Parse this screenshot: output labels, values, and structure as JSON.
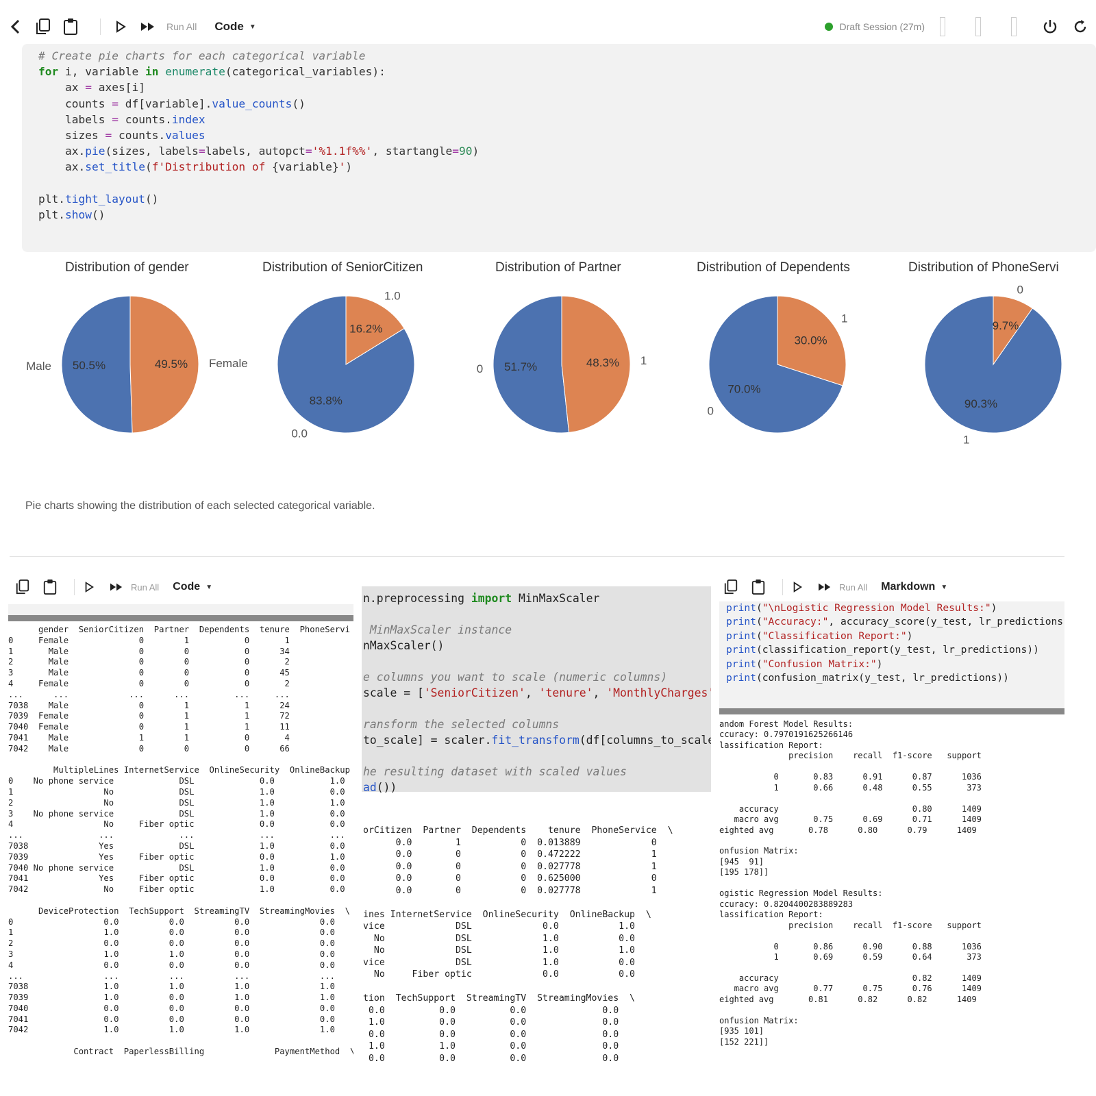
{
  "top_toolbar": {
    "run_all": "Run All",
    "cell_type": "Code",
    "session": "Draft Session (27m)",
    "session_status_color": "#2ca02c",
    "icons": [
      "back-icon",
      "copy-icon",
      "clipboard-icon",
      "run-icon",
      "run-all-icon",
      "power-icon",
      "refresh-icon"
    ]
  },
  "top_code": {
    "comment": "# Create pie charts for each categorical variable"
  },
  "charts_caption": "Pie charts showing the distribution of each selected categorical variable.",
  "chart_data": [
    {
      "type": "pie",
      "title": "Distribution of gender",
      "labels": [
        "Male",
        "Female"
      ],
      "values": [
        50.5,
        49.5
      ],
      "value_labels": [
        "50.5%",
        "49.5%"
      ],
      "colors": [
        "#4c72b0",
        "#dd8452"
      ],
      "startangle": 90
    },
    {
      "type": "pie",
      "title": "Distribution of SeniorCitizen",
      "labels": [
        "0.0",
        "1.0"
      ],
      "values": [
        83.8,
        16.2
      ],
      "value_labels": [
        "83.8%",
        "16.2%"
      ],
      "colors": [
        "#4c72b0",
        "#dd8452"
      ],
      "startangle": 90
    },
    {
      "type": "pie",
      "title": "Distribution of Partner",
      "labels": [
        "0",
        "1"
      ],
      "values": [
        51.7,
        48.3
      ],
      "value_labels": [
        "51.7%",
        "48.3%"
      ],
      "colors": [
        "#4c72b0",
        "#dd8452"
      ],
      "startangle": 90
    },
    {
      "type": "pie",
      "title": "Distribution of Dependents",
      "labels": [
        "0",
        "1"
      ],
      "values": [
        70.0,
        30.0
      ],
      "value_labels": [
        "70.0%",
        "30.0%"
      ],
      "colors": [
        "#4c72b0",
        "#dd8452"
      ],
      "startangle": 90
    },
    {
      "type": "pie",
      "title": "Distribution of PhoneServi",
      "labels": [
        "1",
        "0"
      ],
      "values": [
        90.3,
        9.7
      ],
      "value_labels": [
        "90.3%",
        "9.7%"
      ],
      "colors": [
        "#4c72b0",
        "#dd8452"
      ],
      "startangle": 90
    }
  ],
  "left_panel": {
    "run_all": "Run All",
    "cell_type": "Code",
    "output": [
      "      gender  SeniorCitizen  Partner  Dependents  tenure  PhoneServi",
      "0     Female              0        1           0       1",
      "1       Male              0        0           0      34",
      "2       Male              0        0           0       2",
      "3       Male              0        0           0      45",
      "4     Female              0        0           0       2",
      "...      ...            ...      ...         ...     ...",
      "7038    Male              0        1           1      24",
      "7039  Female              0        1           1      72",
      "7040  Female              0        1           1      11",
      "7041    Male              1        1           0       4",
      "7042    Male              0        0           0      66",
      "",
      "         MultipleLines InternetService  OnlineSecurity  OnlineBackup",
      "0    No phone service             DSL             0.0           1.0",
      "1                  No             DSL             1.0           0.0",
      "2                  No             DSL             1.0           1.0",
      "3    No phone service             DSL             1.0           0.0",
      "4                  No     Fiber optic             0.0           0.0",
      "...               ...             ...             ...           ...",
      "7038              Yes             DSL             1.0           0.0",
      "7039              Yes     Fiber optic             0.0           1.0",
      "7040 No phone service             DSL             1.0           0.0",
      "7041              Yes     Fiber optic             0.0           0.0",
      "7042               No     Fiber optic             1.0           0.0",
      "",
      "      DeviceProtection  TechSupport  StreamingTV  StreamingMovies  \\",
      "0                  0.0          0.0          0.0              0.0",
      "1                  1.0          0.0          0.0              0.0",
      "2                  0.0          0.0          0.0              0.0",
      "3                  1.0          1.0          0.0              0.0",
      "4                  0.0          0.0          0.0              0.0",
      "...                ...          ...          ...              ...",
      "7038               1.0          1.0          1.0              1.0",
      "7039               1.0          0.0          1.0              1.0",
      "7040               0.0          0.0          0.0              0.0",
      "7041               0.0          0.0          0.0              0.0",
      "7042               1.0          1.0          1.0              1.0",
      "",
      "             Contract  PaperlessBilling              PaymentMethod  \\"
    ]
  },
  "middle_panel": {
    "code_lines": [
      [
        {
          "t": "n.preprocessing ",
          "c": ""
        },
        {
          "t": "import",
          "c": "kw"
        },
        {
          "t": " MinMaxScaler",
          "c": ""
        }
      ],
      [],
      [
        {
          "t": " MinMaxScaler instance",
          "c": "cm"
        }
      ],
      [
        {
          "t": "nMaxScaler()",
          "c": ""
        }
      ],
      [],
      [
        {
          "t": "e columns you want to scale (numeric columns)",
          "c": "cm"
        }
      ],
      [
        {
          "t": "scale = [",
          "c": ""
        },
        {
          "t": "'SeniorCitizen'",
          "c": "st"
        },
        {
          "t": ", ",
          "c": ""
        },
        {
          "t": "'tenure'",
          "c": "st"
        },
        {
          "t": ", ",
          "c": ""
        },
        {
          "t": "'MonthlyCharges'",
          "c": "st"
        },
        {
          "t": ",",
          "c": ""
        }
      ],
      [],
      [
        {
          "t": "ransform the selected columns",
          "c": "cm"
        }
      ],
      [
        {
          "t": "to_scale] = scaler.",
          "c": ""
        },
        {
          "t": "fit_transform",
          "c": "at"
        },
        {
          "t": "(df[columns_to_scale",
          "c": ""
        }
      ],
      [],
      [
        {
          "t": "he resulting dataset with scaled values",
          "c": "cm"
        }
      ],
      [
        {
          "t": "ad",
          "c": "at"
        },
        {
          "t": "())",
          "c": ""
        }
      ]
    ],
    "output": [
      "orCitizen  Partner  Dependents    tenure  PhoneService  \\",
      "      0.0        1           0  0.013889             0",
      "      0.0        0           0  0.472222             1",
      "      0.0        0           0  0.027778             1",
      "      0.0        0           0  0.625000             0",
      "      0.0        0           0  0.027778             1",
      "",
      "ines InternetService  OnlineSecurity  OnlineBackup  \\",
      "vice             DSL             0.0           1.0",
      "  No             DSL             1.0           0.0",
      "  No             DSL             1.0           1.0",
      "vice             DSL             1.0           0.0",
      "  No     Fiber optic             0.0           0.0",
      "",
      "tion  TechSupport  StreamingTV  StreamingMovies  \\",
      " 0.0          0.0          0.0              0.0",
      " 1.0          0.0          0.0              0.0",
      " 0.0          0.0          0.0              0.0",
      " 1.0          1.0          0.0              0.0",
      " 0.0          0.0          0.0              0.0"
    ]
  },
  "right_panel": {
    "run_all": "Run All",
    "cell_type": "Markdown",
    "code_lines": [
      [
        {
          "t": "print",
          "c": "at"
        },
        {
          "t": "(",
          "c": ""
        },
        {
          "t": "\"\\nLogistic Regression Model Results:\"",
          "c": "st"
        },
        {
          "t": ")",
          "c": ""
        }
      ],
      [
        {
          "t": "print",
          "c": "at"
        },
        {
          "t": "(",
          "c": ""
        },
        {
          "t": "\"Accuracy:\"",
          "c": "st"
        },
        {
          "t": ", accuracy_score(y_test, lr_predictions))",
          "c": ""
        }
      ],
      [
        {
          "t": "print",
          "c": "at"
        },
        {
          "t": "(",
          "c": ""
        },
        {
          "t": "\"Classification Report:\"",
          "c": "st"
        },
        {
          "t": ")",
          "c": ""
        }
      ],
      [
        {
          "t": "print",
          "c": "at"
        },
        {
          "t": "(classification_report(y_test, lr_predictions))",
          "c": ""
        }
      ],
      [
        {
          "t": "print",
          "c": "at"
        },
        {
          "t": "(",
          "c": ""
        },
        {
          "t": "\"Confusion Matrix:\"",
          "c": "st"
        },
        {
          "t": ")",
          "c": ""
        }
      ],
      [
        {
          "t": "print",
          "c": "at"
        },
        {
          "t": "(confusion_matrix(y_test, lr_predictions))",
          "c": ""
        }
      ]
    ],
    "output": [
      "andom Forest Model Results:",
      "ccuracy: 0.7970191625266146",
      "lassification Report:",
      "              precision    recall  f1-score   support",
      "",
      "           0       0.83      0.91      0.87      1036",
      "           1       0.66      0.48      0.55       373",
      "",
      "    accuracy                           0.80      1409",
      "   macro avg       0.75      0.69      0.71      1409",
      "eighted avg       0.78      0.80      0.79      1409",
      "",
      "onfusion Matrix:",
      "[945  91]",
      "[195 178]]",
      "",
      "ogistic Regression Model Results:",
      "ccuracy: 0.8204400283889283",
      "lassification Report:",
      "              precision    recall  f1-score   support",
      "",
      "           0       0.86      0.90      0.88      1036",
      "           1       0.69      0.59      0.64       373",
      "",
      "    accuracy                           0.82      1409",
      "   macro avg       0.77      0.75      0.76      1409",
      "eighted avg       0.81      0.82      0.82      1409",
      "",
      "onfusion Matrix:",
      "[935 101]",
      "[152 221]]"
    ]
  }
}
